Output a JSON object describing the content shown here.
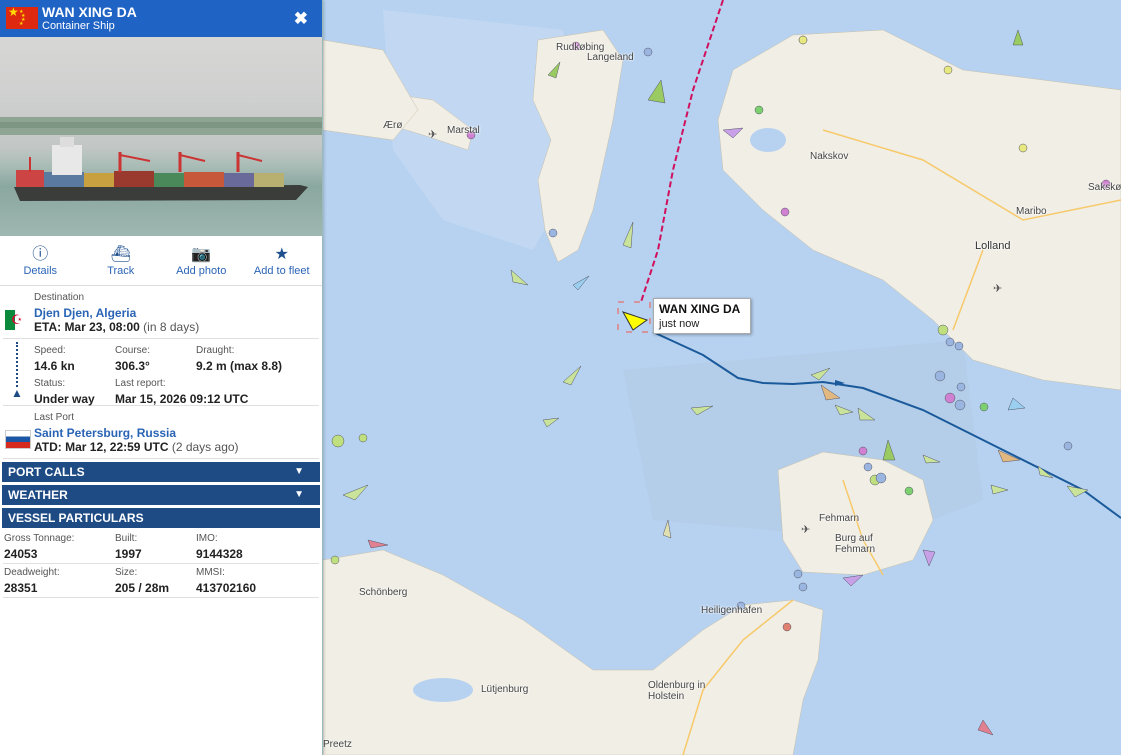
{
  "panel": {
    "vessel_name": "WAN XING DA",
    "vessel_type": "Container Ship",
    "close_glyph": "✖",
    "flag_icon": "china-flag-icon",
    "actions": [
      {
        "label": "Details",
        "icon": "info-icon"
      },
      {
        "label": "Track",
        "icon": "ship-icon"
      },
      {
        "label": "Add photo",
        "icon": "camera-icon"
      },
      {
        "label": "Add to fleet",
        "icon": "star-icon"
      }
    ],
    "destination": {
      "label": "Destination",
      "port": "Djen Djen, Algeria",
      "eta": "ETA: Mar 23, 08:00",
      "eta_note": "(in 8 days)"
    },
    "voyage": {
      "speed_label": "Speed:",
      "speed": "14.6 kn",
      "course_label": "Course:",
      "course": "306.3°",
      "draught_label": "Draught:",
      "draught": "9.2 m (max 8.8)",
      "status_label": "Status:",
      "status": "Under way",
      "report_label": "Last report:",
      "report": "Mar 15, 2026 09:12 UTC"
    },
    "last_port": {
      "label": "Last Port",
      "port": "Saint Petersburg, Russia",
      "atd": "ATD: Mar 12, 22:59 UTC",
      "atd_note": "(2 days ago)"
    },
    "sections": [
      "PORT CALLS",
      "WEATHER",
      "VESSEL PARTICULARS"
    ],
    "particulars": {
      "gt_label": "Gross Tonnage:",
      "gt": "24053",
      "built_label": "Built:",
      "built": "1997",
      "imo_label": "IMO:",
      "imo": "9144328",
      "dwt_label": "Deadweight:",
      "dwt": "28351",
      "size_label": "Size:",
      "size": "205 / 28m",
      "mmsi_label": "MMSI:",
      "mmsi": "413702160"
    }
  },
  "map": {
    "tooltip": {
      "name": "WAN XING DA",
      "time": "just now"
    },
    "places": [
      "Rudkøbing",
      "Langeland",
      "Ærø",
      "Marstal",
      "Nakskov",
      "Lolland",
      "Maribo",
      "Sakskøbing",
      "Fehmarn",
      "Burg auf Fehmarn",
      "Heiligenhafen",
      "Schönberg",
      "Lütjenburg",
      "Oldenburg in Holstein",
      "Preetz"
    ],
    "colors": {
      "water": "#b7d2f0",
      "land": "#f1eee6",
      "track": "#1a5a9a",
      "route": "#d0105c"
    }
  }
}
